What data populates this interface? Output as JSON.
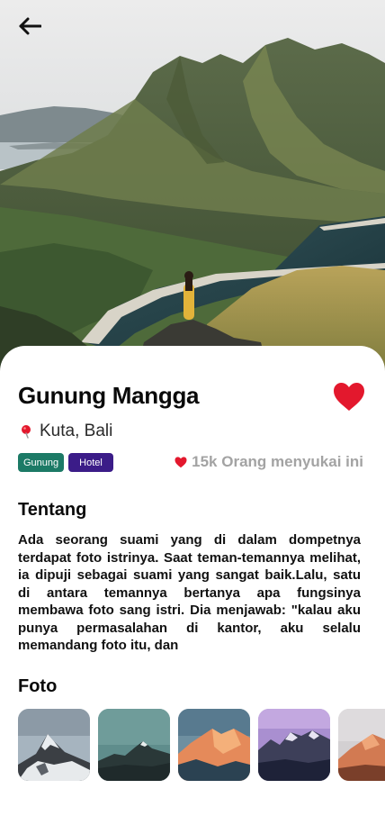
{
  "destination": {
    "name": "Gunung Mangga",
    "location": "Kuta, Bali",
    "tags": [
      "Gunung",
      "Hotel"
    ],
    "likes_text": "15k Orang menyukai ini"
  },
  "about": {
    "heading": "Tentang",
    "text": "Ada seorang suami yang di dalam dompetnya terdapat foto istrinya. Saat teman-temannya melihat, ia dipuji sebagai suami yang sangat baik.Lalu, satu di antara temannya bertanya apa fungsinya membawa foto sang istri. Dia menjawab: \"kalau aku punya permasalahan di kantor, aku selalu memandang foto itu, dan"
  },
  "gallery": {
    "heading": "Foto",
    "photos": [
      "matterhorn-snow-peak",
      "teal-mountain-ridge",
      "sunset-glow-peak",
      "purple-dusk-range",
      "orange-cliff-peak"
    ]
  },
  "colors": {
    "heart": "#e3182d",
    "tag_green": "#1c7a66",
    "tag_purple": "#3b1c88",
    "muted_text": "#a3a3a3"
  },
  "icons": {
    "back": "arrow-left-icon",
    "favorite": "heart-icon",
    "location": "map-pin-icon",
    "likes": "heart-small-icon"
  }
}
